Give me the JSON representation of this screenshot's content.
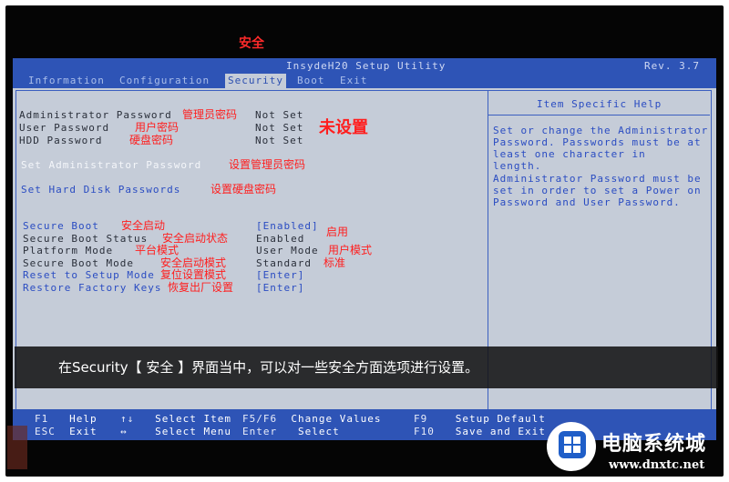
{
  "annotation_title": "安全",
  "bios": {
    "title": "InsydeH20 Setup Utility",
    "rev": "Rev. 3.7",
    "tabs": [
      {
        "label": "Information"
      },
      {
        "label": "Configuration"
      },
      {
        "label": "Security"
      },
      {
        "label": "Boot"
      },
      {
        "label": "Exit"
      }
    ],
    "settings": [
      {
        "label": "Administrator Password",
        "value": "Not Set",
        "note": "管理员密码"
      },
      {
        "label": "User Password",
        "value": "Not Set",
        "note": "用户密码"
      },
      {
        "label": "HDD Password",
        "value": "Not Set",
        "note": "硬盘密码"
      },
      {
        "label": "Set Administrator Password",
        "value": "",
        "note": "设置管理员密码"
      },
      {
        "label": "Set Hard Disk Passwords",
        "value": "",
        "note": "设置硬盘密码"
      },
      {
        "label": "Secure Boot",
        "value": "[Enabled]",
        "note": "安全启动",
        "value_note": "启用"
      },
      {
        "label": "Secure Boot Status",
        "value": "Enabled",
        "note": "安全启动状态"
      },
      {
        "label": "Platform Mode",
        "value": "User Mode",
        "note": "平台模式",
        "value_note": "用户模式"
      },
      {
        "label": "Secure Boot Mode",
        "value": "Standard",
        "note": "安全启动模式",
        "value_note": "标准"
      },
      {
        "label": "Reset to Setup Mode",
        "value": "[Enter]",
        "note": "复位设置模式"
      },
      {
        "label": "Restore Factory Keys",
        "value": "[Enter]",
        "note": "恢复出厂设置"
      }
    ],
    "not_set_note": "未设置",
    "help": {
      "title": "Item Specific Help",
      "lines": [
        "Set or change the Administrator",
        "Password. Passwords must be at",
        " least one character in",
        "length.",
        "Administrator Password must be",
        "set in order to set a Power on",
        "Password and User Password."
      ]
    },
    "footer": [
      {
        "key": "F1",
        "desc": "Help"
      },
      {
        "key": "ESC",
        "desc": "Exit"
      },
      {
        "key": "↑↓",
        "desc": "Select Item"
      },
      {
        "key": "↔",
        "desc": "Select Menu"
      },
      {
        "key": "F5/F6",
        "desc": "Change Values"
      },
      {
        "key": "Enter",
        "desc": "Select"
      },
      {
        "key": "F9",
        "desc": "Setup Default"
      },
      {
        "key": "F10",
        "desc": "Save and Exit"
      }
    ]
  },
  "caption": "在Security【 安全 】界面当中，可以对一些安全方面选项进行设置。",
  "watermark": {
    "name": "电脑系统城",
    "url": "www.dnxtc.net"
  }
}
